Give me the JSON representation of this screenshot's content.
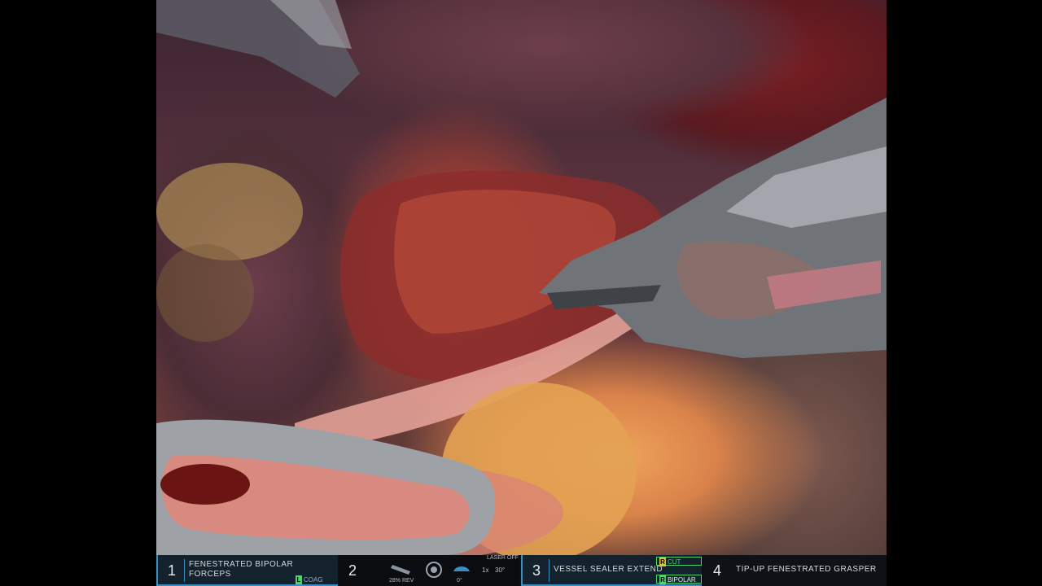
{
  "hud": {
    "arm1": {
      "number": "1",
      "line1": "FENESTRATED BIPOLAR",
      "line2": "FORCEPS",
      "energy_key": "L",
      "energy_label": "COAG"
    },
    "arm2": {
      "number": "2",
      "laser": "LASER OFF",
      "rev": "28% REV",
      "angle_zero": "0°",
      "zoom": "1x",
      "angle": "30°"
    },
    "arm3": {
      "number": "3",
      "label": "VESSEL SEALER EXTEND",
      "cut_key": "R",
      "cut_label": "CUT",
      "bipolar_key": "R",
      "bipolar_label": "BIPOLAR"
    },
    "arm4": {
      "number": "4",
      "label": "TIP-UP FENESTRATED GRASPER"
    }
  },
  "colors": {
    "accent_blue": "#3a8ec4",
    "energy_green": "#4fd16b",
    "energy_yellow": "#e6c12a"
  }
}
